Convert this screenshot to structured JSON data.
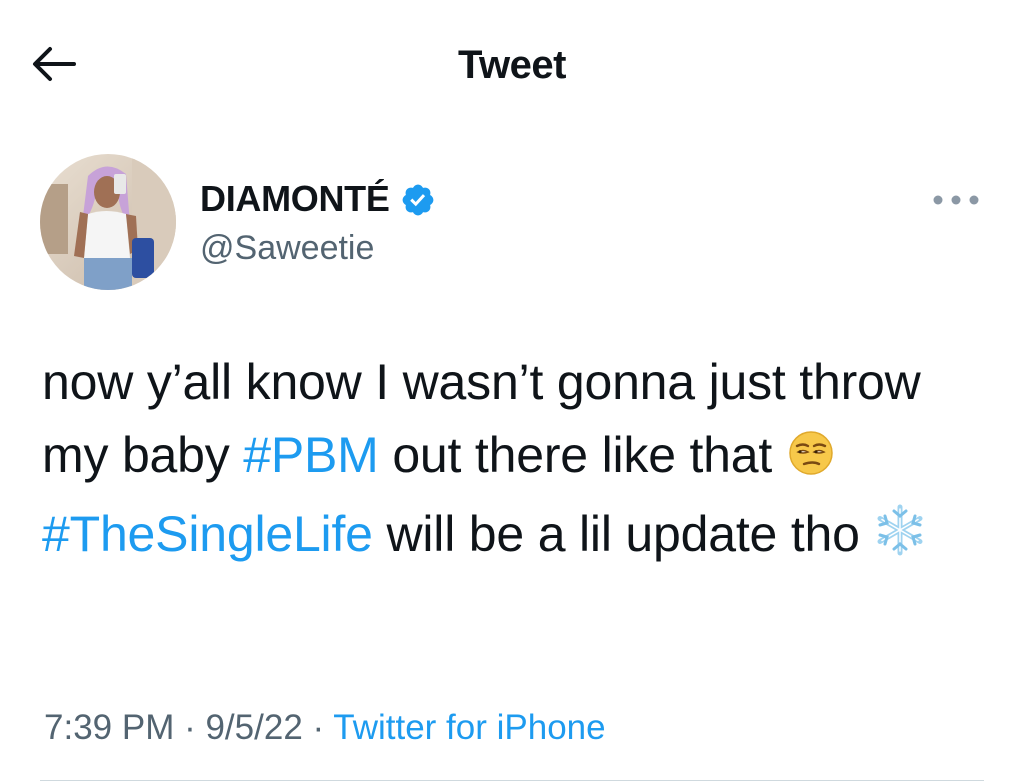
{
  "header": {
    "title": "Tweet"
  },
  "author": {
    "name": "DIAMONTÉ",
    "handle": "@Saweetie",
    "verified": true
  },
  "tweet": {
    "text_1": "now y’all know I wasn’t gonna just throw my baby ",
    "hashtag_1": "#PBM",
    "text_2": " out there like that ",
    "emoji_1": "unamused-face",
    "text_3": " ",
    "hashtag_2": "#TheSingleLife",
    "text_4": " will be a lil update tho ",
    "emoji_2": "snowflake"
  },
  "meta": {
    "time": "7:39 PM",
    "sep_1": " · ",
    "date": "9/5/22",
    "sep_2": " · ",
    "source": "Twitter for iPhone"
  },
  "colors": {
    "link": "#1d9bf0",
    "secondary_text": "#536471",
    "primary_text": "#0f1419"
  }
}
